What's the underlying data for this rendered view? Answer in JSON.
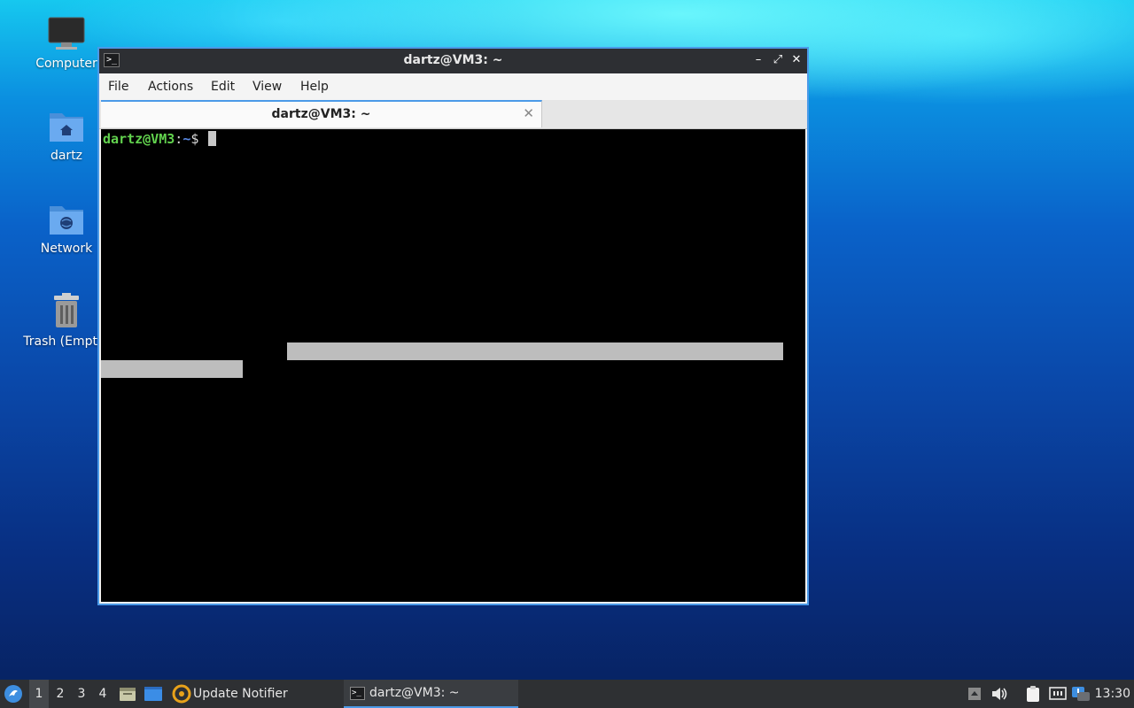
{
  "desktop": {
    "icons": [
      {
        "label": "Computer"
      },
      {
        "label": "dartz"
      },
      {
        "label": "Network"
      },
      {
        "label": "Trash (Empty)"
      }
    ]
  },
  "window": {
    "title": "dartz@VM3: ~",
    "menu": [
      "File",
      "Actions",
      "Edit",
      "View",
      "Help"
    ],
    "tab_label": "dartz@VM3: ~",
    "terminal": {
      "user_host": "dartz@VM3",
      "separator": ":",
      "path": "~",
      "dollar": "$ "
    }
  },
  "taskbar": {
    "workspaces": [
      "1",
      "2",
      "3",
      "4"
    ],
    "active_workspace": "1",
    "update_notifier": "Update Notifier",
    "task_label": "dartz@VM3: ~",
    "clock": "13:30"
  },
  "colors": {
    "accent": "#4b9ae8",
    "prompt_user": "#62d24e",
    "prompt_path": "#5a8ae6"
  }
}
